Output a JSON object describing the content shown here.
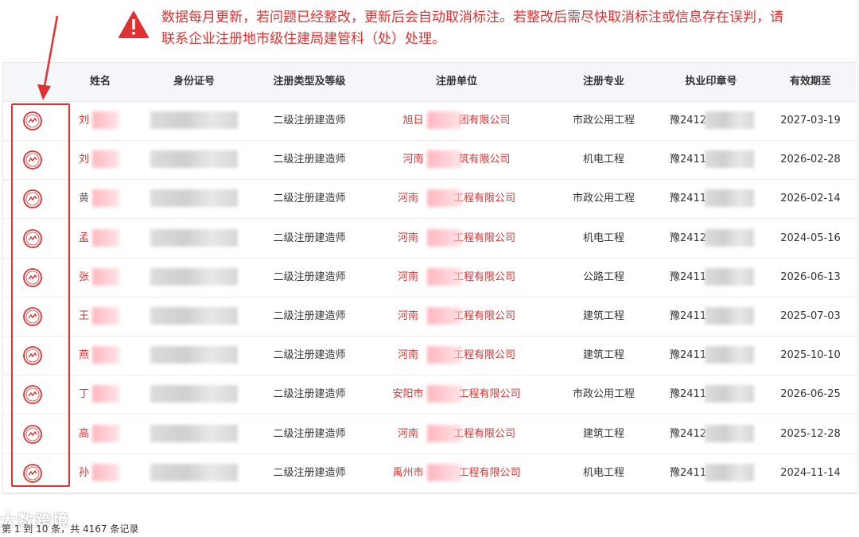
{
  "notice": {
    "line1": "数据每月更新，若问题已经整改，更新后会自动取消标注。若整改后需尽快取消标注或信息存在误判，请",
    "line2": "联系企业注册地市级住建局建管科（处）处理。",
    "icon": "warning-icon",
    "color": "#e03232"
  },
  "table": {
    "headers": [
      "姓名",
      "身份证号",
      "注册类型及等级",
      "注册单位",
      "注册专业",
      "执业印章号",
      "有效期至"
    ],
    "rows": [
      {
        "name": "刘",
        "type": "二级注册建造师",
        "unit_prefix": "旭日",
        "unit_suffix": "团有限公司",
        "specialty": "市政公用工程",
        "seal": "豫2412",
        "expiry": "2027-03-19"
      },
      {
        "name": "刘",
        "type": "二级注册建造师",
        "unit_prefix": "河南",
        "unit_suffix": "筑有限公司",
        "specialty": "机电工程",
        "seal": "豫2411",
        "expiry": "2026-02-28"
      },
      {
        "name": "黄",
        "type": "二级注册建造师",
        "unit_prefix": "河南",
        "unit_suffix": "工程有限公司",
        "specialty": "市政公用工程",
        "seal": "豫2411",
        "expiry": "2026-02-14"
      },
      {
        "name": "孟",
        "type": "二级注册建造师",
        "unit_prefix": "河南",
        "unit_suffix": "工程有限公司",
        "specialty": "机电工程",
        "seal": "豫2412",
        "expiry": "2024-05-16"
      },
      {
        "name": "张",
        "type": "二级注册建造师",
        "unit_prefix": "河南",
        "unit_suffix": "工程有限公司",
        "specialty": "公路工程",
        "seal": "豫2411",
        "expiry": "2026-06-13"
      },
      {
        "name": "王",
        "type": "二级注册建造师",
        "unit_prefix": "河南",
        "unit_suffix": "工程有限公司",
        "specialty": "建筑工程",
        "seal": "豫2411",
        "expiry": "2025-07-03"
      },
      {
        "name": "燕",
        "type": "二级注册建造师",
        "unit_prefix": "河南",
        "unit_suffix": "工程有限公司",
        "specialty": "建筑工程",
        "seal": "豫2411",
        "expiry": "2025-10-10"
      },
      {
        "name": "丁",
        "type": "二级注册建造师",
        "unit_prefix": "安阳市",
        "unit_suffix": "工程有限公司",
        "specialty": "市政公用工程",
        "seal": "豫2411",
        "expiry": "2026-06-25"
      },
      {
        "name": "高",
        "type": "二级注册建造师",
        "unit_prefix": "河南",
        "unit_suffix": "工程有限公司",
        "specialty": "建筑工程",
        "seal": "豫2412",
        "expiry": "2025-12-28"
      },
      {
        "name": "孙",
        "type": "二级注册建造师",
        "unit_prefix": "禹州市",
        "unit_suffix": "工程有限公司",
        "specialty": "机电工程",
        "seal": "豫2411",
        "expiry": "2024-11-14"
      }
    ],
    "stamp_icon": "flag-stamp-icon"
  },
  "footer": {
    "pagination": "第 1 到 10 条，共 4167 条记录"
  },
  "watermark": "大数跨境",
  "colors": {
    "accent": "#e03232",
    "header_bg": "#f4f6f9",
    "border": "#e6e6e6"
  }
}
